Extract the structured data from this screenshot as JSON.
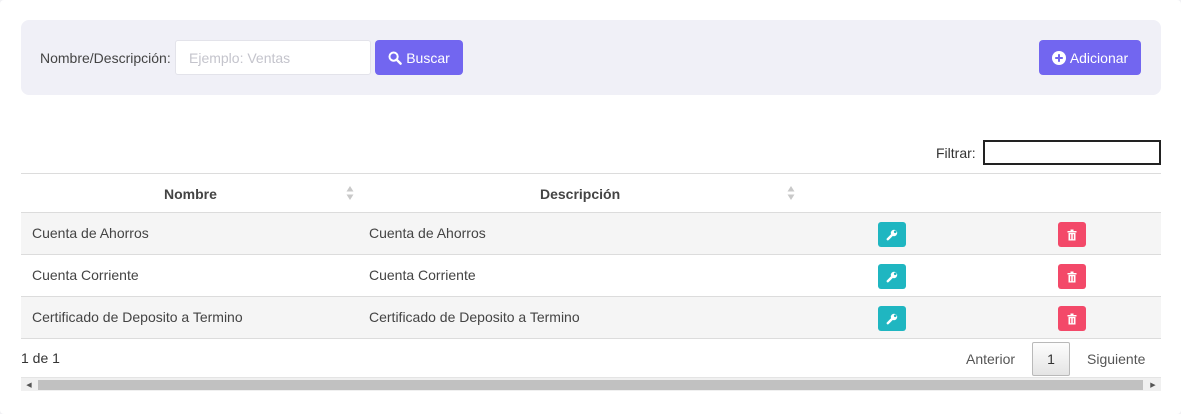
{
  "search": {
    "label": "Nombre/Descripción:",
    "placeholder": "Ejemplo: Ventas",
    "value": "",
    "search_button": "Buscar",
    "search_icon": "search-icon",
    "add_button": "Adicionar",
    "add_icon": "plus-circle-icon"
  },
  "filter": {
    "label": "Filtrar:",
    "value": ""
  },
  "table": {
    "columns": [
      "Nombre",
      "Descripción"
    ],
    "rows": [
      {
        "nombre": "Cuenta de Ahorros",
        "descripcion": "Cuenta de Ahorros"
      },
      {
        "nombre": "Cuenta Corriente",
        "descripcion": "Cuenta Corriente"
      },
      {
        "nombre": "Certificado de Deposito a Termino",
        "descripcion": "Certificado de Deposito a Termino"
      }
    ],
    "edit_icon": "wrench-icon",
    "delete_icon": "trash-icon"
  },
  "pagination": {
    "info": "1 de 1",
    "previous": "Anterior",
    "current": "1",
    "next": "Siguiente"
  },
  "colors": {
    "primary": "#7266f0",
    "edit": "#1fb6c1",
    "delete": "#f34969",
    "panel": "#f0f0f7"
  }
}
